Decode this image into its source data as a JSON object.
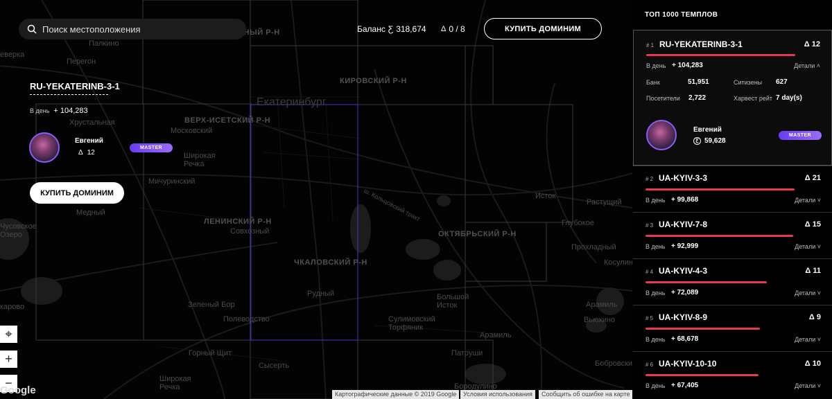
{
  "search": {
    "placeholder": "Поиск местоположения"
  },
  "header": {
    "balance_label": "Баланс",
    "balance_currency_symbol": "Ƹ",
    "balance_value": "318,674",
    "delta_symbol": "Δ",
    "delta_value": "0 / 8",
    "buy_button": "КУПИТЬ ДОМИНИМ"
  },
  "map": {
    "labels": {
      "zheleznodorozhny": "ЖЕЛЕЗНОДОРОЖНЫЙ Р-Н",
      "palkino": "Палкино",
      "zeverka": "еверка",
      "peregon": "Перегон",
      "kirovsky": "КИРОВСКИЙ Р-Н",
      "ekaterinburg": "Екатеринбург",
      "verkh_isetsky": "ВЕРХ-ИСЕТСКИЙ Р-Н",
      "khrustalnaya": "Хрустальная",
      "moskovsky": "Московский",
      "shirokaya_rechka": "Широкая Речка",
      "michurinsky": "Мичуринский",
      "medny": "Медный",
      "istok": "Исток",
      "rastushchy": "Растущий",
      "leninsky": "ЛЕНИНСКИЙ Р-Н",
      "sovkhozny": "Совхозный",
      "glubokoe": "Глубокое",
      "oktyabrsky": "ОКТЯБРЬСКИЙ Р-Н",
      "prokhladny": "Прохладный",
      "chkalovsky": "ЧКАЛОВСКИЙ Р-Н",
      "kosulino": "Косулин",
      "chusovskoe": "Чусовское Озеро",
      "rudny": "Рудный",
      "bolshoy_istok": "Большой Исток",
      "karovo": "карово",
      "zeleny_bor": "Зеленый Бор",
      "polevodstvo": "Полеводство",
      "sulimovsky": "Сулимовский Торфяник",
      "aramil1": "Арамиль",
      "vyuhino": "Вьюхино",
      "aramil2": "Арамиль",
      "gorny_shchit": "Горный Щит",
      "patrushi": "Патруши",
      "sysert": "Сысерть",
      "shirokaya_rechka2": "Широкая Речка",
      "borodulino": "Бородулино",
      "bobrovsky": "Бобровский",
      "kolcovsky": "ш. Кольцовский тракт"
    },
    "google": "Google",
    "attribution": {
      "data": "Картографические данные © 2019 Google",
      "terms": "Условия использования",
      "report": "Сообщить об ошибке на карте"
    },
    "controls": {
      "locate": "⌖",
      "zoom_in": "+",
      "zoom_out": "−"
    }
  },
  "info": {
    "title": "RU-YEKATERINB-3-1",
    "perday_label": "В день",
    "perday_value": "+ 104,283",
    "owner_name": "Евгений",
    "owner_delta_symbol": "Δ",
    "owner_delta": "12",
    "badge": "MASTER",
    "buy_button": "КУПИТЬ ДОМИНИМ"
  },
  "panel": {
    "title": "ТОП 1000 ТЕМПЛОВ",
    "details_label": "Детали",
    "perday_label": "В день",
    "items": [
      {
        "rank": "# 1",
        "name": "RU-YEKATERINB-3-1",
        "delta": "Δ 12",
        "perday": "+ 104,283",
        "bar": 0.86,
        "expanded": true
      },
      {
        "rank": "# 2",
        "name": "UA-KYIV-3-3",
        "delta": "Δ 21",
        "perday": "+ 99,868",
        "bar": 0.86
      },
      {
        "rank": "# 3",
        "name": "UA-KYIV-7-8",
        "delta": "Δ 15",
        "perday": "+ 92,999",
        "bar": 0.85
      },
      {
        "rank": "# 4",
        "name": "UA-KYIV-4-3",
        "delta": "Δ 11",
        "perday": "+ 72,089",
        "bar": 0.7
      },
      {
        "rank": "# 5",
        "name": "UA-KYIV-8-9",
        "delta": "Δ 9",
        "perday": "+ 68,678",
        "bar": 0.66
      },
      {
        "rank": "# 6",
        "name": "UA-KYIV-10-10",
        "delta": "Δ 10",
        "perday": "+ 67,405",
        "bar": 0.65
      }
    ],
    "expanded": {
      "bank_label": "Банк",
      "bank_value": "51,951",
      "citizens_label": "Ситизены",
      "citizens_value": "627",
      "visitors_label": "Посетители",
      "visitors_value": "2,722",
      "harvest_label": "Харвест рейт",
      "harvest_value": "7 day(s)",
      "owner_name": "Евгений",
      "owner_coins": "59,628",
      "coin_symbol": "Ƹ",
      "badge": "MASTER"
    }
  },
  "colors": {
    "accent_bar": "#e8384f",
    "badge": "#7a4cf2",
    "background": "#000000"
  }
}
